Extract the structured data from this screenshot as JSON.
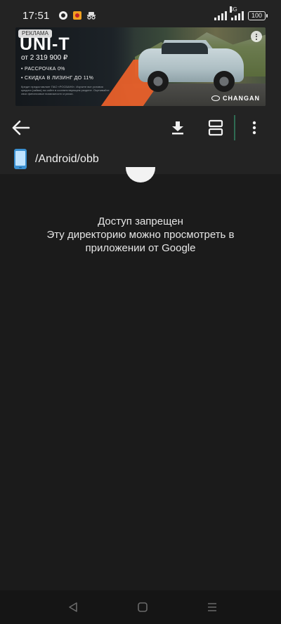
{
  "status_bar": {
    "time": "17:51",
    "network_type": "4G",
    "battery": "100"
  },
  "ad": {
    "tag": "РЕКЛАМА",
    "model": "UNI-T",
    "price": "от 2 319 900 ₽",
    "bullets": [
      "• РАССРОЧКА 0%",
      "• СКИДКА В ЛИЗИНГ ДО 11%"
    ],
    "fine_print": "Кредит предоставляет ПАО «РОСБАНК». Изучите все условия кредита (займа) на сайте в соответствующем разделе. Оценивайте свои финансовые возможности и риски.",
    "brand": "CHANGAN"
  },
  "toolbar": {
    "back_icon": "arrow-left-icon",
    "download_icon": "download-icon",
    "view_icon": "view-toggle-icon",
    "more_icon": "more-vert-icon"
  },
  "path": {
    "text": "/Android/obb",
    "icon": "phone-storage-icon"
  },
  "message": {
    "line1": "Доступ запрещен",
    "line2": "Эту директорию можно просмотреть в",
    "line3": "приложении от Google"
  },
  "colors": {
    "background": "#1b1b1b",
    "bar": "#232323",
    "accent_divider": "#2f6b52",
    "ad_orange": "#e8602a"
  }
}
